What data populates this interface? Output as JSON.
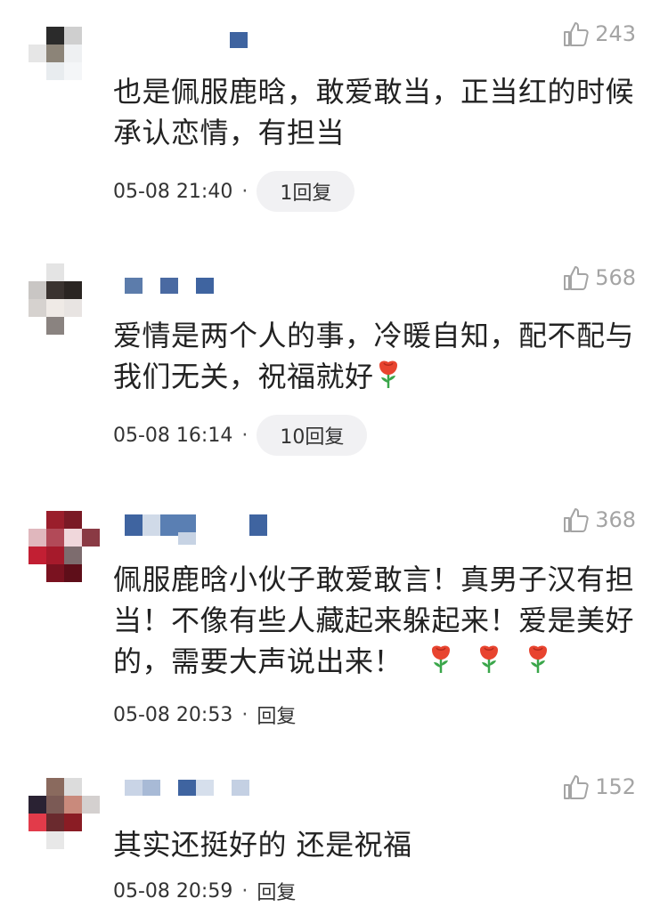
{
  "icons": {
    "like": "thumbs-up-icon",
    "rose": "rose-icon"
  },
  "colors": {
    "like_gray": "#a4a4a4",
    "pill_bg": "#f1f1f3",
    "text": "#222222"
  },
  "comments": [
    {
      "likes": "243",
      "text": "也是佩服鹿晗，敢爱敢当，正当红的时候承认恋情，有担当",
      "emoji_count": 0,
      "time": "05-08 21:40",
      "reply": "1回复"
    },
    {
      "likes": "568",
      "text": "爱情是两个人的事，冷暖自知，配不配与我们无关，祝福就好",
      "emoji_count": 1,
      "time": "05-08 16:14",
      "reply": "10回复"
    },
    {
      "likes": "368",
      "text": "佩服鹿晗小伙子敢爱敢言！真男子汉有担当！不像有些人藏起来躲起来！爱是美好的，需要大声说出来！",
      "emoji_count": 3,
      "time": "05-08 20:53",
      "reply": "回复"
    },
    {
      "likes": "152",
      "text": "其实还挺好的 还是祝福",
      "emoji_count": 0,
      "time": "05-08 20:59",
      "reply": "回复"
    }
  ]
}
